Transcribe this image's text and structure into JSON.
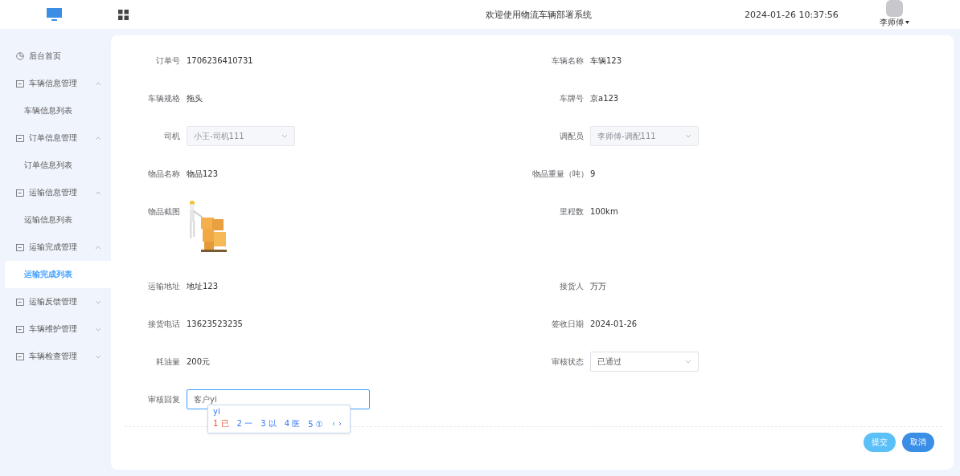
{
  "header": {
    "title": "欢迎使用物流车辆部署系统",
    "datetime": "2024-01-26 10:37:56",
    "user": "李师傅"
  },
  "sidebar": {
    "items": [
      {
        "label": "后台首页",
        "kind": "home"
      },
      {
        "label": "车辆信息管理",
        "kind": "group",
        "expanded": true,
        "children": [
          {
            "label": "车辆信息列表",
            "selected": false
          }
        ]
      },
      {
        "label": "订单信息管理",
        "kind": "group",
        "expanded": true,
        "children": [
          {
            "label": "订单信息列表",
            "selected": false
          }
        ]
      },
      {
        "label": "运输信息管理",
        "kind": "group",
        "expanded": true,
        "children": [
          {
            "label": "运输信息列表",
            "selected": false
          }
        ]
      },
      {
        "label": "运输完成管理",
        "kind": "group",
        "expanded": true,
        "children": [
          {
            "label": "运输完成列表",
            "selected": true
          }
        ]
      },
      {
        "label": "运输反馈管理",
        "kind": "group",
        "expanded": false
      },
      {
        "label": "车辆维护管理",
        "kind": "group",
        "expanded": false
      },
      {
        "label": "车辆检查管理",
        "kind": "group",
        "expanded": false
      }
    ]
  },
  "form": {
    "rows": [
      [
        {
          "label": "订单号",
          "kind": "text",
          "value": "1706236410731"
        },
        {
          "label": "车辆名称",
          "kind": "text",
          "value": "车辆123"
        }
      ],
      [
        {
          "label": "车辆规格",
          "kind": "text",
          "value": "拖头"
        },
        {
          "label": "车牌号",
          "kind": "text",
          "value": "京a123"
        }
      ],
      [
        {
          "label": "司机",
          "kind": "select",
          "value": "小王-司机111",
          "disabled": true
        },
        {
          "label": "调配员",
          "kind": "select",
          "value": "李师傅-调配111",
          "disabled": true
        }
      ],
      [
        {
          "label": "物品名称",
          "kind": "text",
          "value": "物品123"
        },
        {
          "label": "物品重量（吨）",
          "kind": "text",
          "value": "9"
        }
      ],
      [
        {
          "label": "物品截图",
          "kind": "picture"
        },
        {
          "label": "里程数",
          "kind": "text",
          "value": "100km"
        }
      ],
      [
        {
          "label": "运输地址",
          "kind": "text",
          "value": "地址123"
        },
        {
          "label": "接货人",
          "kind": "text",
          "value": "万万"
        }
      ],
      [
        {
          "label": "接货电话",
          "kind": "text",
          "value": "13623523235"
        },
        {
          "label": "签收日期",
          "kind": "text",
          "value": "2024-01-26"
        }
      ],
      [
        {
          "label": "耗油量",
          "kind": "text",
          "value": "200元"
        },
        {
          "label": "审核状态",
          "kind": "select",
          "value": "已通过",
          "disabled": false
        }
      ],
      [
        {
          "label": "审核回复",
          "kind": "input",
          "value": "客户yi",
          "focused": true
        }
      ]
    ]
  },
  "ime": {
    "composition": "yi",
    "candidates": [
      {
        "index": "1",
        "text": "已",
        "selected": true
      },
      {
        "index": "2",
        "text": "一",
        "selected": false
      },
      {
        "index": "3",
        "text": "以",
        "selected": false
      },
      {
        "index": "4",
        "text": "医",
        "selected": false
      },
      {
        "index": "5",
        "text": "①",
        "selected": false
      }
    ]
  },
  "buttons": [
    {
      "label": "提交",
      "kind": "secondary"
    },
    {
      "label": "取消",
      "kind": "primary"
    }
  ]
}
